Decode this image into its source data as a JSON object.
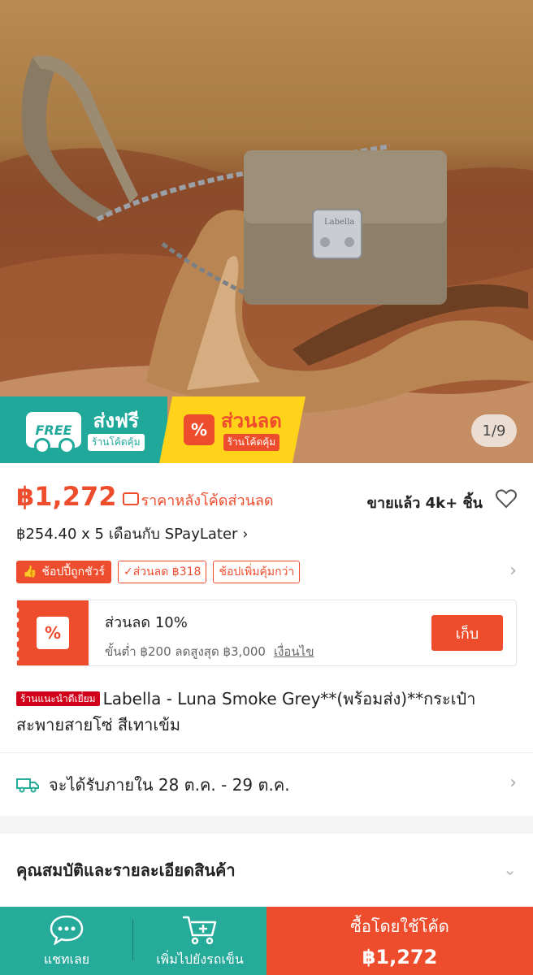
{
  "gallery": {
    "counter": "1/9",
    "promo_free": {
      "icon_text": "FREE",
      "title": "ส่งฟรี",
      "subtitle": "ร้านโค้ดคุ้ม"
    },
    "promo_discount": {
      "icon_text": "%",
      "title": "ส่วนลด",
      "subtitle": "ร้านโค้ดคุ้ม"
    },
    "image_label": "Labella"
  },
  "price": {
    "amount": "฿1,272",
    "note": "ราคาหลังโค้ดส่วนลด",
    "sold": "ขายแล้ว 4k+ ชิ้น",
    "installment": "฿254.40 x 5 เดือนกับ SPayLater",
    "installment_chevron": "›"
  },
  "badges": {
    "guarantee": "ช้อปปี้ถูกชัวร์",
    "discount": "✓ส่วนลด ฿318",
    "more": "ช้อปเพิ่มคุ้มกว่า",
    "chevron": "›"
  },
  "voucher": {
    "icon_text": "%",
    "title": "ส่วนลด 10%",
    "condition": "ขั้นต่ำ ฿200 ลดสูงสุด ฿3,000",
    "terms_link": "เงื่อนไข",
    "collect_label": "เก็บ"
  },
  "product": {
    "tag": "ร้านแนะนำดีเยี่ยม",
    "title": "Labella - Luna Smoke Grey**(พร้อมส่ง)**กระเป๋าสะพายสายโซ่ สีเทาเข้ม"
  },
  "delivery": {
    "text": "จะได้รับภายใน 28 ต.ค. - 29 ต.ค.",
    "chevron": "›"
  },
  "spec": {
    "title": "คุณสมบัติและรายละเอียดสินค้า",
    "chevron": "⌄"
  },
  "bottom_bar": {
    "chat_label": "แชทเลย",
    "cart_label": "เพิ่มไปยังรถเข็น",
    "buy_label": "ซื้อโดยใช้โค้ด",
    "buy_price": "฿1,272"
  },
  "colors": {
    "accent": "#ee4d2d",
    "teal": "#26aa99",
    "promo_yellow": "#ffd31a"
  }
}
